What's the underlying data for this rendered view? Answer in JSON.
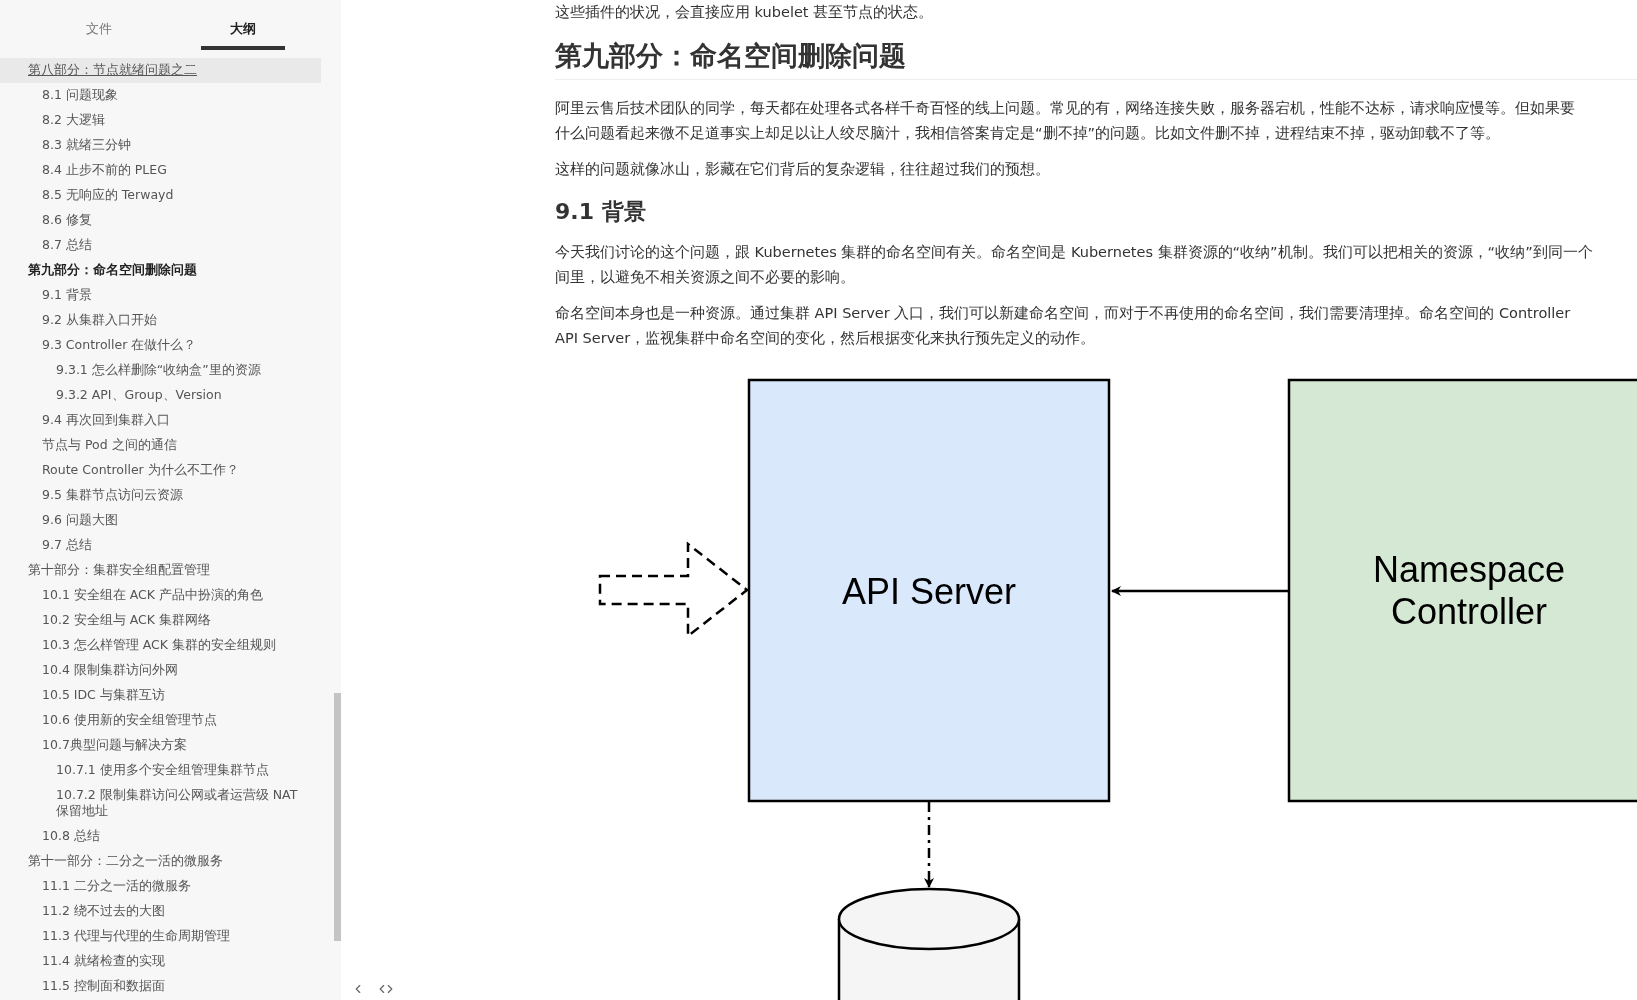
{
  "sidebar": {
    "tabs": [
      {
        "label": "文件",
        "selected": false
      },
      {
        "label": "大纲",
        "selected": true
      }
    ],
    "outline": [
      {
        "label": "第八部分：节点就绪问题之二",
        "highlighted": true,
        "current": false,
        "children": [
          {
            "label": "8.1 问题现象",
            "highlighted": false,
            "current": false
          },
          {
            "label": "8.2 大逻辑",
            "highlighted": false,
            "current": false
          },
          {
            "label": "8.3 就绪三分钟",
            "highlighted": false,
            "current": false
          },
          {
            "label": "8.4 止步不前的 PLEG",
            "highlighted": false,
            "current": false
          },
          {
            "label": "8.5 无响应的 Terwayd",
            "highlighted": false,
            "current": false
          },
          {
            "label": "8.6 修复",
            "highlighted": false,
            "current": false
          },
          {
            "label": "8.7 总结",
            "highlighted": false,
            "current": false
          }
        ]
      },
      {
        "label": "第九部分：命名空间删除问题",
        "highlighted": false,
        "current": true,
        "children": [
          {
            "label": "9.1 背景",
            "highlighted": false,
            "current": false
          },
          {
            "label": "9.2 从集群入口开始",
            "highlighted": false,
            "current": false
          },
          {
            "label": "9.3 Controller 在做什么？",
            "highlighted": false,
            "current": false,
            "children": [
              {
                "label": "9.3.1 怎么样删除“收纳盒”里的资源",
                "highlighted": false,
                "current": false
              },
              {
                "label": "9.3.2 API、Group、Version",
                "highlighted": false,
                "current": false
              }
            ]
          },
          {
            "label": "9.4 再次回到集群入口",
            "highlighted": false,
            "current": false
          },
          {
            "label": "节点与 Pod 之间的通信",
            "highlighted": false,
            "current": false
          },
          {
            "label": "Route Controller 为什么不工作？",
            "highlighted": false,
            "current": false
          },
          {
            "label": "9.5 集群节点访问云资源",
            "highlighted": false,
            "current": false
          },
          {
            "label": "9.6 问题大图",
            "highlighted": false,
            "current": false
          },
          {
            "label": "9.7 总结",
            "highlighted": false,
            "current": false
          }
        ]
      },
      {
        "label": "第十部分：集群安全组配置管理",
        "highlighted": false,
        "current": false,
        "children": [
          {
            "label": "10.1 安全组在 ACK 产品中扮演的角色",
            "highlighted": false,
            "current": false
          },
          {
            "label": "10.2 安全组与 ACK 集群网络",
            "highlighted": false,
            "current": false
          },
          {
            "label": "10.3 怎么样管理 ACK 集群的安全组规则",
            "highlighted": false,
            "current": false
          },
          {
            "label": "10.4 限制集群访问外网",
            "highlighted": false,
            "current": false
          },
          {
            "label": "10.5 IDC 与集群互访",
            "highlighted": false,
            "current": false
          },
          {
            "label": "10.6 使用新的安全组管理节点",
            "highlighted": false,
            "current": false
          },
          {
            "label": "10.7典型问题与解决方案",
            "highlighted": false,
            "current": false,
            "children": [
              {
                "label": "10.7.1 使用多个安全组管理集群节点",
                "highlighted": false,
                "current": false
              },
              {
                "label": "10.7.2 限制集群访问公网或者运营级 NAT 保留地址",
                "highlighted": false,
                "current": false
              }
            ]
          },
          {
            "label": "10.8 总结",
            "highlighted": false,
            "current": false
          }
        ]
      },
      {
        "label": "第十一部分：二分之一活的微服务",
        "highlighted": false,
        "current": false,
        "children": [
          {
            "label": "11.1 二分之一活的微服务",
            "highlighted": false,
            "current": false
          },
          {
            "label": "11.2 绕不过去的大图",
            "highlighted": false,
            "current": false
          },
          {
            "label": "11.3 代理与代理的生命周期管理",
            "highlighted": false,
            "current": false
          },
          {
            "label": "11.4 就绪检查的实现",
            "highlighted": false,
            "current": false
          },
          {
            "label": "11.5 控制面和数据面",
            "highlighted": false,
            "current": false
          }
        ]
      }
    ]
  },
  "document": [
    {
      "kind": "paragraph",
      "lines": [
        "这些插件的状况，会直接应用 kubelet 甚至节点的状态。"
      ]
    },
    {
      "kind": "h1",
      "text": "第九部分：命名空间删除问题"
    },
    {
      "kind": "paragraph",
      "lines": [
        "阿里云售后技术团队的同学，每天都在处理各式各样千奇百怪的线上问题。常见的有，网络连接失败，服务器宕机，性能不达标，请求响应慢等。但如果要",
        "什么问题看起来微不足道事实上却足以让人绞尽脑汁，我相信答案肯定是“删不掉”的问题。比如文件删不掉，进程结束不掉，驱动卸载不了等。"
      ]
    },
    {
      "kind": "paragraph",
      "lines": [
        "这样的问题就像冰山，影藏在它们背后的复杂逻辑，往往超过我们的预想。"
      ]
    },
    {
      "kind": "h2",
      "text": "9.1 背景"
    },
    {
      "kind": "paragraph",
      "lines": [
        "今天我们讨论的这个问题，跟 Kubernetes 集群的命名空间有关。命名空间是 Kubernetes 集群资源的“收纳”机制。我们可以把相关的资源，“收纳”到同一个",
        "间里，以避免不相关资源之间不必要的影响。"
      ]
    },
    {
      "kind": "paragraph",
      "lines": [
        "命名空间本身也是一种资源。通过集群 API Server 入口，我们可以新建命名空间，而对于不再使用的命名空间，我们需要清理掉。命名空间的 Controller",
        "API Server，监视集群中命名空间的变化，然后根据变化来执行预先定义的动作。"
      ]
    }
  ],
  "diagram": {
    "api_box": "API Server",
    "controller_box": [
      "Namespace",
      "Controller"
    ]
  }
}
